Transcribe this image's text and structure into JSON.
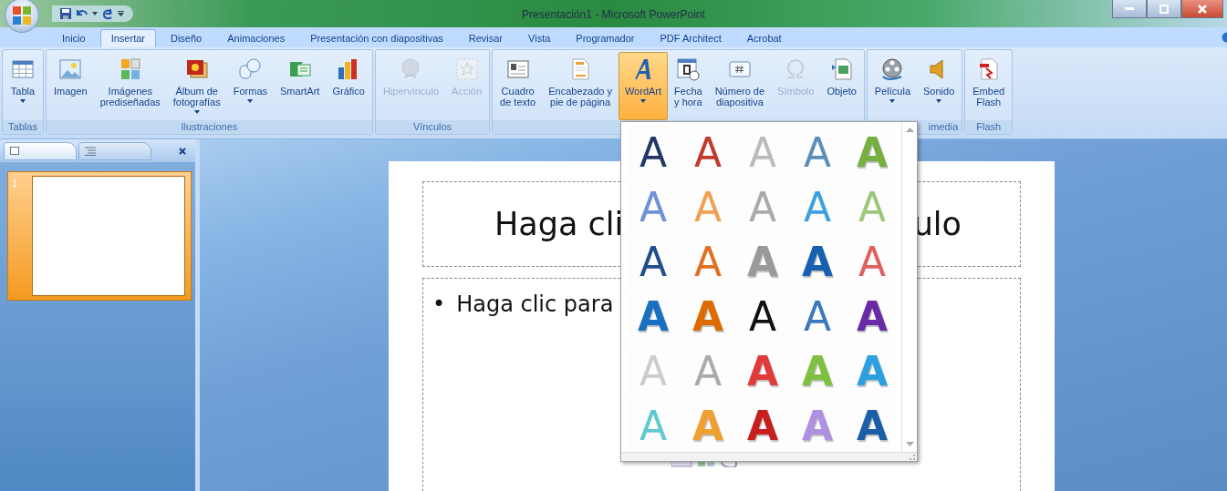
{
  "window": {
    "title": "Presentación1 - Microsoft PowerPoint"
  },
  "tabs": [
    {
      "label": "Inicio",
      "selected": false
    },
    {
      "label": "Insertar",
      "selected": true
    },
    {
      "label": "Diseño",
      "selected": false
    },
    {
      "label": "Animaciones",
      "selected": false
    },
    {
      "label": "Presentación con diapositivas",
      "selected": false
    },
    {
      "label": "Revisar",
      "selected": false
    },
    {
      "label": "Vista",
      "selected": false
    },
    {
      "label": "Programador",
      "selected": false
    },
    {
      "label": "PDF Architect",
      "selected": false
    },
    {
      "label": "Acrobat",
      "selected": false
    }
  ],
  "ribbon": {
    "groups": [
      {
        "label": "Tablas",
        "buttons": [
          {
            "label": "Tabla",
            "dropdown": true,
            "disabled": false,
            "selected": false
          }
        ]
      },
      {
        "label": "Ilustraciones",
        "buttons": [
          {
            "label": "Imagen",
            "dropdown": false,
            "disabled": false,
            "selected": false
          },
          {
            "label": "Imágenes\nprediseñadas",
            "dropdown": false,
            "disabled": false,
            "selected": false
          },
          {
            "label": "Álbum de\nfotografías",
            "dropdown": true,
            "disabled": false,
            "selected": false
          },
          {
            "label": "Formas",
            "dropdown": true,
            "disabled": false,
            "selected": false
          },
          {
            "label": "SmartArt",
            "dropdown": false,
            "disabled": false,
            "selected": false
          },
          {
            "label": "Gráfico",
            "dropdown": false,
            "disabled": false,
            "selected": false
          }
        ]
      },
      {
        "label": "Vínculos",
        "buttons": [
          {
            "label": "Hipervínculo",
            "dropdown": false,
            "disabled": true,
            "selected": false
          },
          {
            "label": "Acción",
            "dropdown": false,
            "disabled": true,
            "selected": false
          }
        ]
      },
      {
        "buttons": [
          {
            "label": "Cuadro\nde texto",
            "dropdown": false,
            "disabled": false,
            "selected": false
          },
          {
            "label": "Encabezado y\npie de página",
            "dropdown": false,
            "disabled": false,
            "selected": false
          },
          {
            "label": "WordArt",
            "dropdown": true,
            "disabled": false,
            "selected": true
          },
          {
            "label": "Fecha\ny hora",
            "dropdown": false,
            "disabled": false,
            "selected": false
          },
          {
            "label": "Número de\ndiapositiva",
            "dropdown": false,
            "disabled": false,
            "selected": false
          },
          {
            "label": "Símbolo",
            "dropdown": false,
            "disabled": true,
            "selected": false
          },
          {
            "label": "Objeto",
            "dropdown": false,
            "disabled": false,
            "selected": false
          }
        ]
      },
      {
        "label": "imedia",
        "buttons": [
          {
            "label": "Película",
            "dropdown": true,
            "disabled": false,
            "selected": false
          },
          {
            "label": "Sonido",
            "dropdown": true,
            "disabled": false,
            "selected": false
          }
        ]
      },
      {
        "label": "Flash",
        "buttons": [
          {
            "label": "Embed\nFlash",
            "dropdown": false,
            "disabled": false,
            "selected": false
          }
        ]
      }
    ]
  },
  "slides_panel": {
    "slides": [
      {
        "number": "1",
        "selected": true
      }
    ]
  },
  "slide": {
    "title_parts": [
      "Haga cli",
      "ulo"
    ],
    "bullet": "•",
    "body": "Haga clic para"
  },
  "wordart_gallery": {
    "items": [
      {
        "label": "A",
        "kind": "outline",
        "color": "#1f3864"
      },
      {
        "label": "A",
        "kind": "outline",
        "color": "#c0392b"
      },
      {
        "label": "A",
        "kind": "outline",
        "color": "#bbbbbb"
      },
      {
        "label": "A",
        "kind": "outline",
        "color": "#5b8fb9"
      },
      {
        "label": "A",
        "kind": "solid",
        "color": "#76b041"
      },
      {
        "label": "A",
        "kind": "outline",
        "color": "#6f8fd8"
      },
      {
        "label": "A",
        "kind": "outline",
        "color": "#f0a050"
      },
      {
        "label": "A",
        "kind": "outline",
        "color": "#aaaaaa"
      },
      {
        "label": "A",
        "kind": "outline",
        "color": "#3aa0e0"
      },
      {
        "label": "A",
        "kind": "outline",
        "color": "#9cc67a"
      },
      {
        "label": "A",
        "kind": "outline",
        "color": "#1f4e8c"
      },
      {
        "label": "A",
        "kind": "outline",
        "color": "#e07020"
      },
      {
        "label": "A",
        "kind": "solid",
        "color": "#999999"
      },
      {
        "label": "A",
        "kind": "solid",
        "color": "#1560b0"
      },
      {
        "label": "A",
        "kind": "outline",
        "color": "#e06060"
      },
      {
        "label": "A",
        "kind": "solid",
        "color": "#1a70c0"
      },
      {
        "label": "A",
        "kind": "solid",
        "color": "#e06a00"
      },
      {
        "label": "A",
        "kind": "outline",
        "color": "#111111"
      },
      {
        "label": "A",
        "kind": "outline",
        "color": "#3a78c0"
      },
      {
        "label": "A",
        "kind": "solid",
        "color": "#6a2aa8"
      },
      {
        "label": "A",
        "kind": "outline",
        "color": "#cccccc"
      },
      {
        "label": "A",
        "kind": "outline",
        "color": "#aaaaaa"
      },
      {
        "label": "A",
        "kind": "solid",
        "color": "#e03a3a"
      },
      {
        "label": "A",
        "kind": "solid",
        "color": "#80c040"
      },
      {
        "label": "A",
        "kind": "solid",
        "color": "#2aa0e0"
      },
      {
        "label": "A",
        "kind": "outline",
        "color": "#60c8d0"
      },
      {
        "label": "A",
        "kind": "solid",
        "color": "#f0a030"
      },
      {
        "label": "A",
        "kind": "solid",
        "color": "#c81e1e"
      },
      {
        "label": "A",
        "kind": "solid",
        "color": "#b090e0"
      },
      {
        "label": "A",
        "kind": "solid",
        "color": "#1a5ea8"
      }
    ]
  }
}
